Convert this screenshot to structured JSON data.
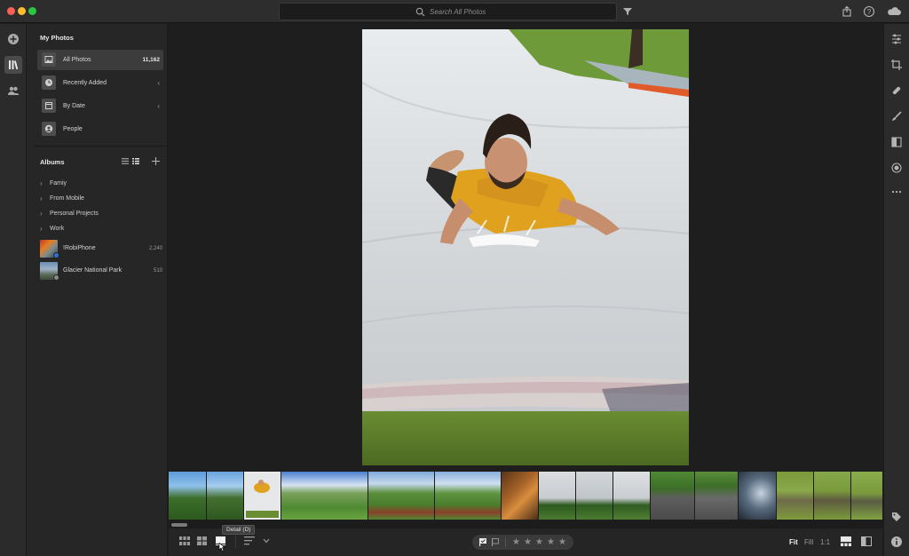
{
  "titlebar": {
    "search_placeholder": "Search All Photos"
  },
  "left_rail": {
    "icons": [
      "add-photos-icon",
      "library-icon",
      "people-shared-icon"
    ]
  },
  "sidebar": {
    "my_photos_title": "My Photos",
    "nav": [
      {
        "label": "All Photos",
        "count": "11,162",
        "icon": "photo-icon",
        "active": true
      },
      {
        "label": "Recently Added",
        "icon": "clock-icon",
        "expandable": true
      },
      {
        "label": "By Date",
        "icon": "calendar-icon",
        "expandable": true
      },
      {
        "label": "People",
        "icon": "person-icon"
      }
    ],
    "albums_title": "Albums",
    "album_folders": [
      "Famiy",
      "From Mobile",
      "Personal Projects",
      "Work"
    ],
    "albums": [
      {
        "label": "!RobiPhone",
        "count": "2,240"
      },
      {
        "label": "Glacier National Park",
        "count": "510"
      }
    ]
  },
  "right_panel": {
    "icons": [
      "edit-sliders-icon",
      "crop-icon",
      "healing-icon",
      "brush-icon",
      "gradient-icon",
      "radial-icon",
      "more-icon",
      "tag-icon",
      "info-icon"
    ]
  },
  "filmstrip": {
    "selected_index": 2,
    "count": 18
  },
  "bottom": {
    "tooltip": "Detail (D)",
    "stars": [
      "★",
      "★",
      "★",
      "★",
      "★"
    ],
    "zoom": {
      "fit": "Fit",
      "fill": "Fill",
      "one_to_one": "1:1"
    }
  },
  "colors": {
    "accent_blue": "#2d6fd6",
    "background": "#1e1e1e",
    "panel": "#262626"
  }
}
